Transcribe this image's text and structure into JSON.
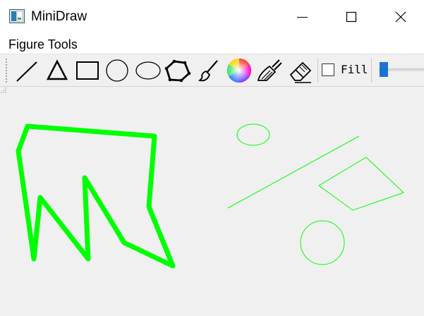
{
  "window": {
    "title": "MiniDraw",
    "app_icon": "paint-app-icon",
    "controls": [
      "minimize-icon",
      "maximize-icon",
      "close-icon"
    ]
  },
  "menu": {
    "items": [
      {
        "label": "Figure Tools"
      }
    ]
  },
  "toolbar": {
    "tools": [
      {
        "name": "line-tool",
        "icon": "line-icon"
      },
      {
        "name": "triangle-tool",
        "icon": "triangle-icon"
      },
      {
        "name": "rectangle-tool",
        "icon": "rectangle-icon"
      },
      {
        "name": "circle-tool",
        "icon": "circle-icon"
      },
      {
        "name": "ellipse-tool",
        "icon": "ellipse-icon"
      },
      {
        "name": "polygon-tool",
        "icon": "polygon-icon"
      },
      {
        "name": "freehand-tool",
        "icon": "brush-icon"
      },
      {
        "name": "color-picker",
        "icon": "color-wheel-icon"
      },
      {
        "name": "clear-tool",
        "icon": "broom-icon"
      },
      {
        "name": "eraser-tool",
        "icon": "eraser-icon"
      }
    ],
    "fill_label": "Fill",
    "fill_checked": false,
    "width_slider_level": 0.05
  },
  "canvas": {
    "stroke_color": "#00ff00",
    "background": "#f0f0f0",
    "shapes": [
      "thick polygon",
      "ellipse",
      "line",
      "quadrilateral",
      "circle"
    ]
  }
}
